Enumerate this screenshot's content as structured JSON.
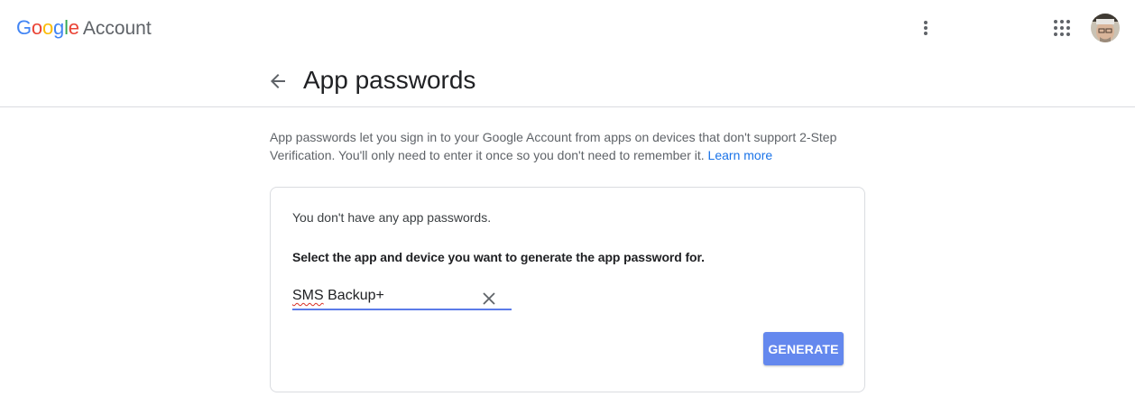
{
  "header": {
    "logo_text": "Google",
    "product_name": "Account",
    "icons": {
      "more": "vertical-dots-icon",
      "apps": "apps-grid-icon",
      "avatar": "user-avatar"
    }
  },
  "page": {
    "title": "App passwords",
    "back_icon": "arrow-back-icon"
  },
  "intro": {
    "text": "App passwords let you sign in to your Google Account from apps on devices that don't support 2-Step Verification. You'll only need to enter it once so you don't need to remember it. ",
    "link_label": "Learn more"
  },
  "card": {
    "empty_message": "You don't have any app passwords.",
    "select_prompt": "Select the app and device you want to generate the app password for.",
    "app_field": {
      "value_first_word": "SMS",
      "value_rest": " Backup+"
    },
    "generate_label": "GENERATE"
  },
  "colors": {
    "link": "#1a73e8",
    "button": "#6488ee",
    "field_underline": "#5b7be9",
    "divider": "#dadce0"
  }
}
